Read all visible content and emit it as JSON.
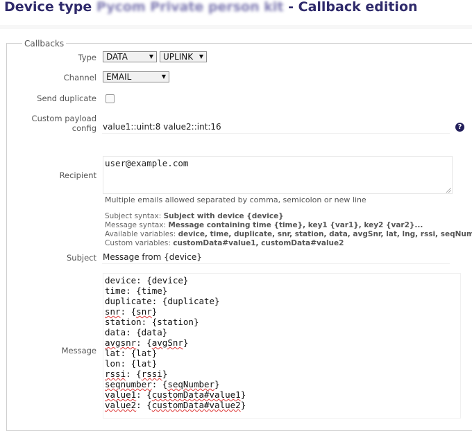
{
  "header": {
    "prefix": "Device type",
    "device_name": "Pycom Private person kit",
    "suffix": "- Callback edition"
  },
  "section": {
    "legend": "Callbacks"
  },
  "type": {
    "label": "Type",
    "kind_value": "DATA",
    "direction_value": "UPLINK"
  },
  "channel": {
    "label": "Channel",
    "value": "EMAIL"
  },
  "send_duplicate": {
    "label": "Send duplicate",
    "checked": false
  },
  "custom_payload": {
    "label_line1": "Custom payload",
    "label_line2": "config",
    "value": "value1::uint:8 value2::int:16",
    "help_icon": "question-circle-icon"
  },
  "recipient": {
    "label": "Recipient",
    "value": "user@example.com",
    "hint": "Multiple emails allowed separated by comma, semicolon or new line"
  },
  "syntax": {
    "subject_label": "Subject syntax:",
    "subject_value": "Subject with device {device}",
    "message_label": "Message syntax:",
    "message_value": "Message containing time {time}, key1 {var1}, key2 {var2}...",
    "available_label": "Available variables:",
    "available_value": "device, time, duplicate, snr, station, data, avgSnr, lat, lng, rssi, seqNumber",
    "custom_label": "Custom variables:",
    "custom_value": "customData#value1, customData#value2"
  },
  "subject": {
    "label": "Subject",
    "value": "Message from {device}"
  },
  "message": {
    "label": "Message",
    "lines": [
      [
        "device: ",
        "{device}"
      ],
      [
        "time: ",
        "{time}"
      ],
      [
        "duplicate: ",
        "{duplicate}"
      ],
      [
        "snr",
        ": ",
        "{snr}"
      ],
      [
        "station: ",
        "{station}"
      ],
      [
        "data: ",
        "{data}"
      ],
      [
        "avgsnr",
        ": ",
        "{avgSnr}"
      ],
      [
        "lat: ",
        "{lat}"
      ],
      [
        "lon: ",
        "{lat}"
      ],
      [
        "rssi",
        ": ",
        "{rssi}"
      ],
      [
        "seqnumber",
        ": ",
        "{seqNumber}"
      ],
      [
        "value1",
        ": ",
        "{customData#value1}"
      ],
      [
        "value2",
        ": ",
        "{customData#value2}"
      ]
    ]
  }
}
